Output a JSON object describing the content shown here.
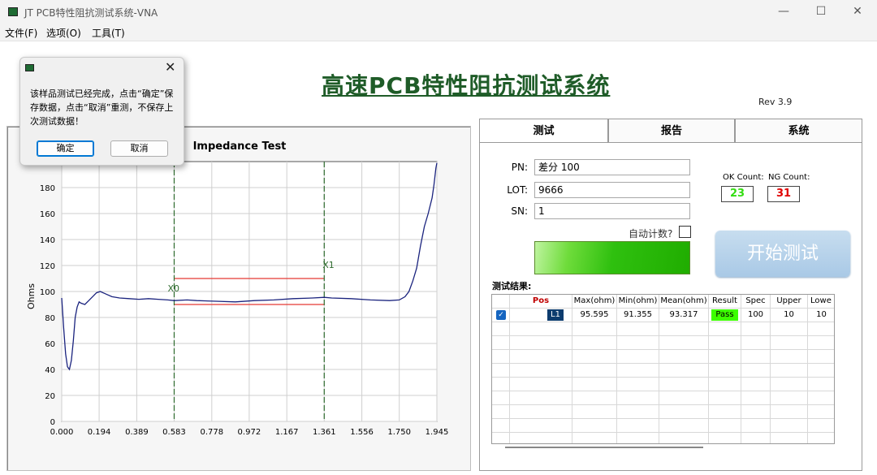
{
  "window": {
    "title": "JT PCB特性阻抗测试系统-VNA",
    "minimize": "—",
    "maximize": "☐",
    "close": "✕"
  },
  "menu": {
    "file": "文件(F)",
    "options": "选项(O)",
    "tools": "工具(T)"
  },
  "header": {
    "title": "高速PCB特性阻抗测试系统",
    "rev": "Rev 3.9"
  },
  "dialog": {
    "close": "✕",
    "message": "该样品测试已经完成，点击“确定”保存数据，点击“取消”重测，不保存上次测试数据！",
    "ok_label": "确定",
    "cancel_label": "取消"
  },
  "tabs": [
    "测试",
    "报告",
    "系统"
  ],
  "form": {
    "pn_label": "PN:",
    "pn_value": "差分   100",
    "lot_label": "LOT:",
    "lot_value": "9666",
    "sn_label": "SN:",
    "sn_value": "1",
    "auto_count_label": "自动计数?"
  },
  "counts": {
    "ok_label": "OK Count:",
    "ok_value": "23",
    "ng_label": "NG Count:",
    "ng_value": "31",
    "ok_color": "#33dd11",
    "ng_color": "#e00000"
  },
  "start_button": "开始测试",
  "results": {
    "label": "测试结果:",
    "columns": [
      "Pos",
      "Max(ohm)",
      "Min(ohm)",
      "Mean(ohm)",
      "Result",
      "Spec",
      "Upper",
      "Lowe"
    ],
    "rows": [
      {
        "pos": "L1",
        "max": "95.595",
        "min": "91.355",
        "mean": "93.317",
        "result": "Pass",
        "spec": "100",
        "upper": "10",
        "lower": "10"
      }
    ]
  },
  "chart_data": {
    "type": "line",
    "title": "Impedance Test",
    "xlabel": "",
    "ylabel": "Ohms",
    "xlim": [
      0.0,
      1.945
    ],
    "ylim": [
      0,
      200
    ],
    "x_ticks": [
      "0.000",
      "0.194",
      "0.389",
      "0.583",
      "0.778",
      "0.972",
      "1.167",
      "1.361",
      "1.556",
      "1.750",
      "1.945"
    ],
    "y_ticks": [
      "0",
      "20",
      "40",
      "60",
      "80",
      "100",
      "120",
      "140",
      "160",
      "180"
    ],
    "grid": true,
    "markers": [
      {
        "name": "X0",
        "x": 0.583
      },
      {
        "name": "X1",
        "x": 1.361
      }
    ],
    "limits": {
      "upper": 110,
      "lower": 90,
      "spec": 100
    },
    "series": [
      {
        "color": "#1a237e",
        "x": [
          0.0,
          0.01,
          0.02,
          0.03,
          0.04,
          0.05,
          0.06,
          0.07,
          0.08,
          0.09,
          0.1,
          0.12,
          0.14,
          0.16,
          0.18,
          0.2,
          0.23,
          0.26,
          0.3,
          0.35,
          0.4,
          0.45,
          0.5,
          0.55,
          0.583,
          0.65,
          0.7,
          0.8,
          0.9,
          1.0,
          1.1,
          1.2,
          1.3,
          1.361,
          1.4,
          1.5,
          1.6,
          1.7,
          1.75,
          1.78,
          1.8,
          1.82,
          1.84,
          1.86,
          1.88,
          1.9,
          1.92,
          1.93,
          1.94,
          1.945
        ],
        "y": [
          95,
          72,
          52,
          42,
          40,
          47,
          62,
          80,
          88,
          92,
          91,
          90,
          93,
          96,
          99,
          100,
          98,
          96,
          95,
          94.5,
          94,
          94.5,
          94,
          93.5,
          93,
          93.5,
          93,
          92.5,
          92,
          93,
          93.5,
          94.5,
          95,
          95.5,
          95,
          94.5,
          93.5,
          93,
          93.5,
          96,
          100,
          108,
          118,
          135,
          150,
          160,
          172,
          182,
          195,
          199
        ]
      }
    ]
  }
}
